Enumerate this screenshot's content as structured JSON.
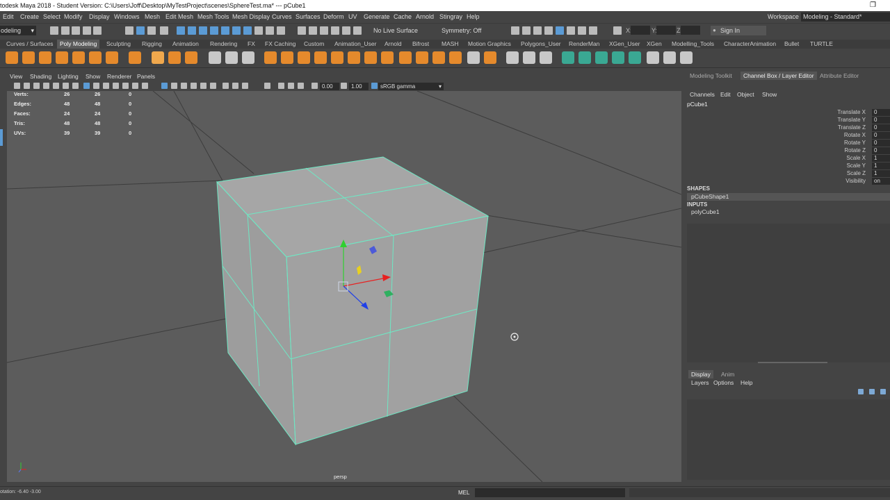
{
  "title": "todesk Maya 2018 - Student Version: C:\\Users\\Joff\\Desktop\\MyTestProject\\scenes\\SphereTest.ma*  ---  pCube1",
  "window_restore_icon": "restore-icon",
  "menus": [
    "Edit",
    "Create",
    "Select",
    "Modify",
    "Display",
    "Windows",
    "Mesh",
    "Edit Mesh",
    "Mesh Tools",
    "Mesh Display",
    "Curves",
    "Surfaces",
    "Deform",
    "UV",
    "Generate",
    "Cache",
    "Arnold",
    "Stingray",
    "Help"
  ],
  "workspace": {
    "label": "Workspace :",
    "value": "Modeling - Standard*"
  },
  "status_line": {
    "mode": "odeling",
    "live_surface": "No Live Surface",
    "symmetry": "Symmetry: Off",
    "x_label": "X:",
    "y_label": "Y:",
    "z_label": "Z:",
    "sign_in": "Sign In"
  },
  "shelf_tabs": [
    "Curves / Surfaces",
    "Poly Modeling",
    "Sculpting",
    "Rigging",
    "Animation",
    "Rendering",
    "FX",
    "FX Caching",
    "Custom",
    "Animation_User",
    "Arnold",
    "Bifrost",
    "MASH",
    "Motion Graphics",
    "Polygons_User",
    "RenderMan",
    "XGen_User",
    "XGen",
    "Modelling_Tools",
    "CharacterAnimation",
    "Bullet",
    "TURTLE"
  ],
  "shelf_active_tab": "Poly Modeling",
  "viewport_menu": [
    "View",
    "Shading",
    "Lighting",
    "Show",
    "Renderer",
    "Panels"
  ],
  "viewport_toolbar": {
    "exposure": "0.00",
    "gamma_value": "1.00",
    "color_space": "sRGB gamma"
  },
  "hud": [
    {
      "label": "Verts:",
      "a": "26",
      "b": "26",
      "c": "0"
    },
    {
      "label": "Edges:",
      "a": "48",
      "b": "48",
      "c": "0"
    },
    {
      "label": "Faces:",
      "a": "24",
      "b": "24",
      "c": "0"
    },
    {
      "label": "Tris:",
      "a": "48",
      "b": "48",
      "c": "0"
    },
    {
      "label": "UVs:",
      "a": "39",
      "b": "39",
      "c": "0"
    }
  ],
  "camera_name": "persp",
  "right_panel": {
    "tabs": [
      "Modeling Toolkit",
      "Channel Box / Layer Editor",
      "Attribute Editor"
    ],
    "active_tab": "Channel Box / Layer Editor",
    "cb_menu": [
      "Channels",
      "Edit",
      "Object",
      "Show"
    ],
    "object": "pCube1",
    "attributes": [
      {
        "name": "Translate X",
        "value": "0"
      },
      {
        "name": "Translate Y",
        "value": "0"
      },
      {
        "name": "Translate Z",
        "value": "0"
      },
      {
        "name": "Rotate X",
        "value": "0"
      },
      {
        "name": "Rotate Y",
        "value": "0"
      },
      {
        "name": "Rotate Z",
        "value": "0"
      },
      {
        "name": "Scale X",
        "value": "1"
      },
      {
        "name": "Scale Y",
        "value": "1"
      },
      {
        "name": "Scale Z",
        "value": "1"
      },
      {
        "name": "Visibility",
        "value": "on"
      }
    ],
    "shapes_label": "SHAPES",
    "shape": "pCubeShape1",
    "inputs_label": "INPUTS",
    "input": "polyCube1",
    "layer_tabs": [
      "Display",
      "Anim"
    ],
    "layer_menu": [
      "Layers",
      "Options",
      "Help"
    ]
  },
  "bottom": {
    "rotation": "otation:   -6.40      -3.00",
    "mel": "MEL"
  },
  "colors": {
    "wire": "#6ee8c4",
    "face": "#a5a5a5",
    "viewport": "#5c5c5c",
    "shelf_orange": "#e58a2c",
    "shelf_teal": "#3aa893"
  }
}
